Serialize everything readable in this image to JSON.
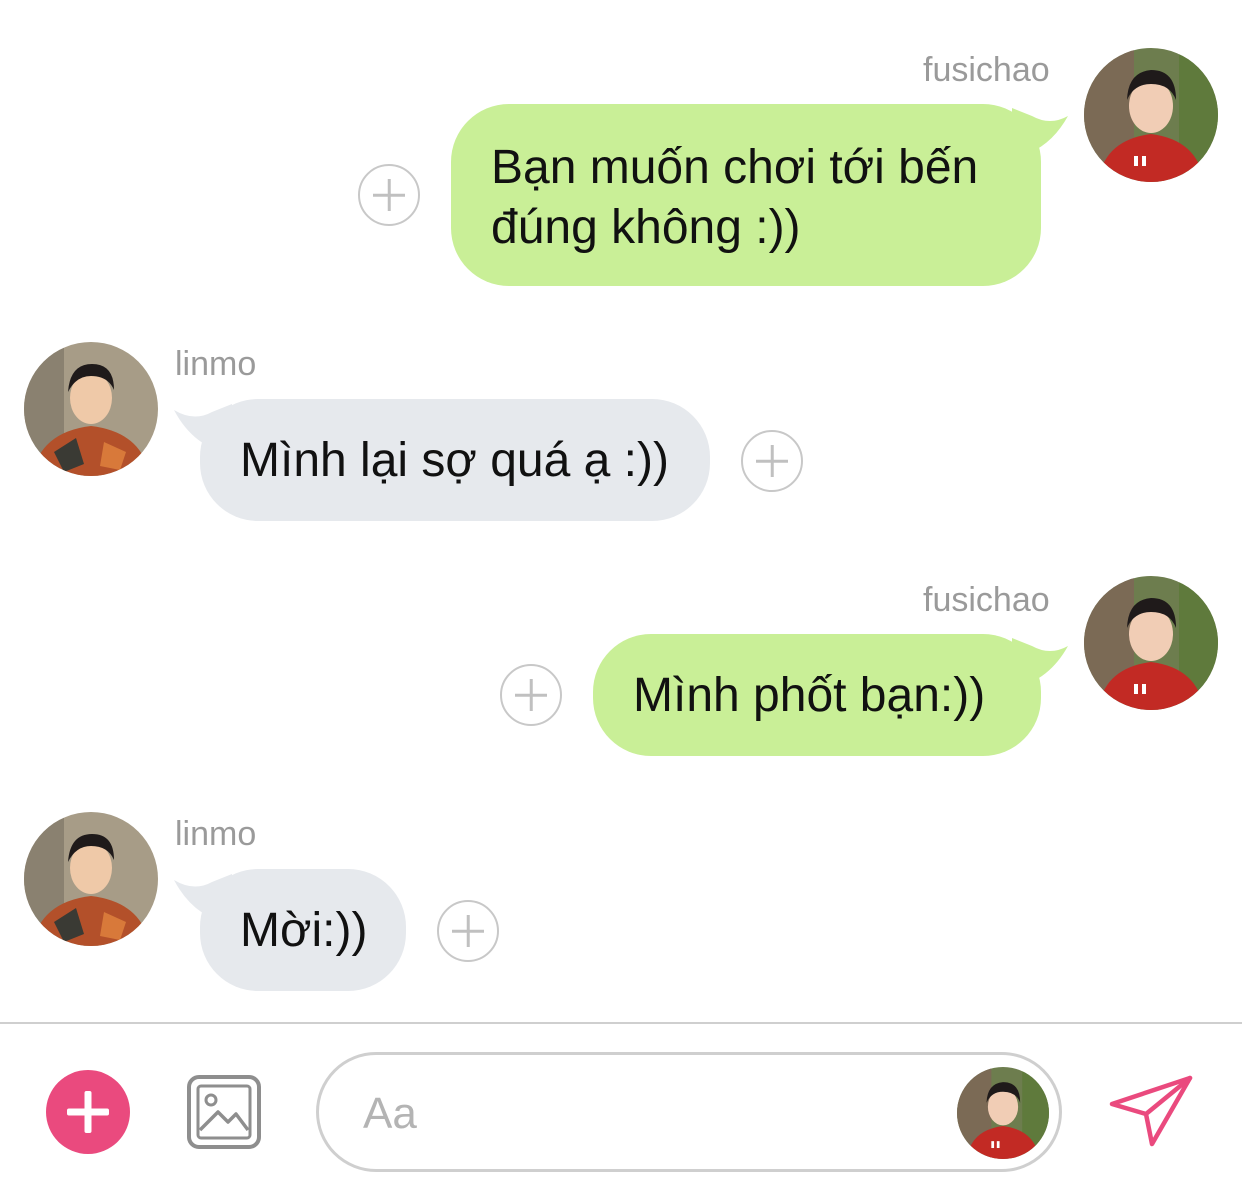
{
  "messages": [
    {
      "sender": "fusichao",
      "direction": "outgoing",
      "lines": [
        "Bạn muốn chơi tới bến",
        "đúng không :))"
      ]
    },
    {
      "sender": "linmo",
      "direction": "incoming",
      "lines": [
        "Mình lại sợ quá ạ :))"
      ]
    },
    {
      "sender": "fusichao",
      "direction": "outgoing",
      "lines": [
        "Mình phốt bạn:))"
      ]
    },
    {
      "sender": "linmo",
      "direction": "incoming",
      "lines": [
        "Mời:))"
      ]
    }
  ],
  "composer": {
    "placeholder": "Aa",
    "add_icon": "plus-icon",
    "image_icon": "image-icon",
    "send_icon": "send-icon"
  },
  "colors": {
    "outgoing_bubble": "#c9ef97",
    "incoming_bubble": "#e6e9ed",
    "accent": "#ea4a7e"
  }
}
